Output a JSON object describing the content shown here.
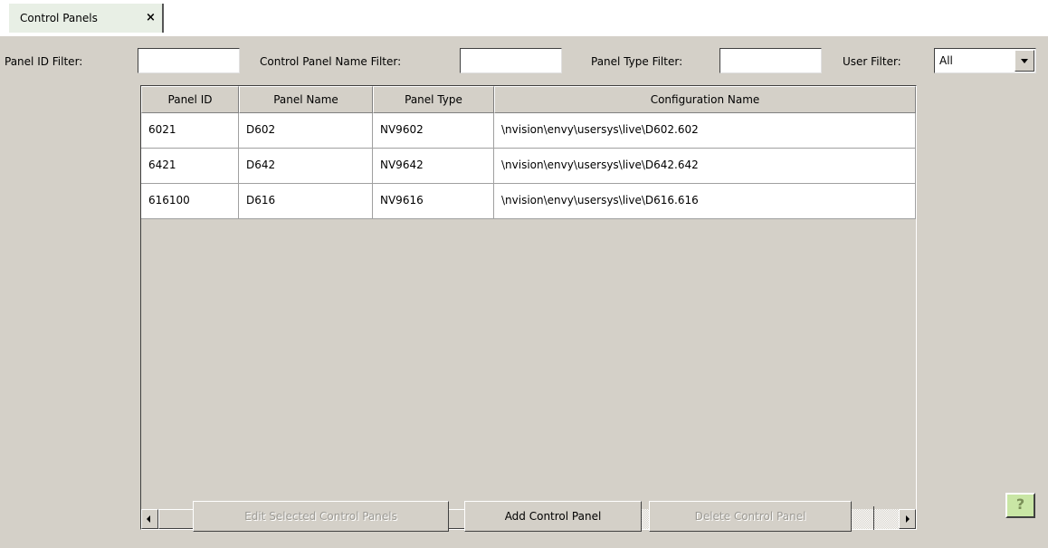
{
  "tab": {
    "label": "Control Panels",
    "close_glyph": "×"
  },
  "filters": {
    "panel_id_label": "Panel ID Filter:",
    "panel_id_value": "",
    "name_label": "Control Panel Name Filter:",
    "name_value": "",
    "type_label": "Panel Type Filter:",
    "type_value": "",
    "user_label": "User Filter:",
    "user_value": "All"
  },
  "table": {
    "columns": [
      "Panel ID",
      "Panel Name",
      "Panel Type",
      "Configuration Name"
    ],
    "rows": [
      [
        "6021",
        "D602",
        "NV9602",
        "\\nvision\\envy\\usersys\\live\\D602.602"
      ],
      [
        "6421",
        "D642",
        "NV9642",
        "\\nvision\\envy\\usersys\\live\\D642.642"
      ],
      [
        "616100",
        "D616",
        "NV9616",
        "\\nvision\\envy\\usersys\\live\\D616.616"
      ]
    ]
  },
  "buttons": {
    "edit": "Edit Selected Control Panels",
    "add": "Add Control Panel",
    "delete": "Delete Control Panel",
    "help": "?"
  },
  "icons": [
    "close-icon",
    "dropdown-arrow-icon",
    "scroll-left-icon",
    "scroll-right-icon",
    "help-icon"
  ]
}
